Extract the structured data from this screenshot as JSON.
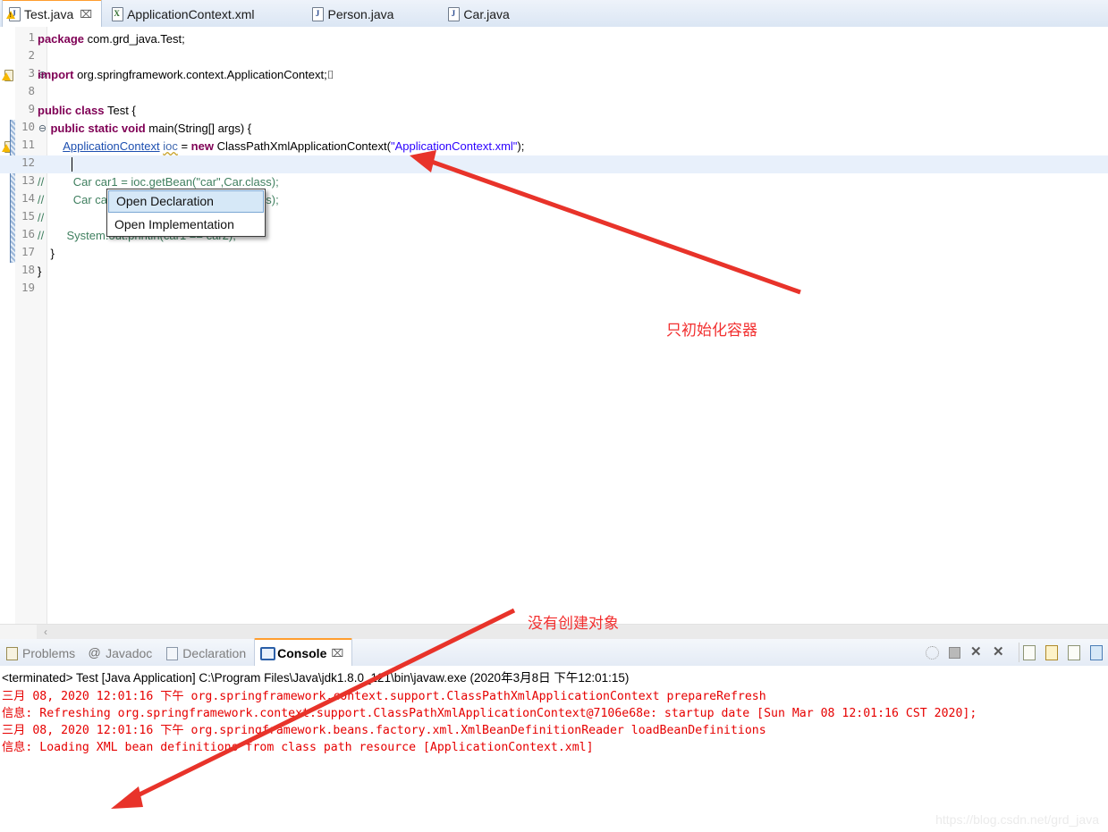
{
  "editor_tabs": [
    {
      "label": "Test.java",
      "icon": "java-file-warning-icon",
      "active": true,
      "closeable": true,
      "close_glyph": "⌧"
    },
    {
      "label": "ApplicationContext.xml",
      "icon": "xml-file-icon",
      "active": false,
      "closeable": false
    },
    {
      "label": "Person.java",
      "icon": "java-file-icon",
      "active": false,
      "closeable": false
    },
    {
      "label": "Car.java",
      "icon": "java-file-icon",
      "active": false,
      "closeable": false
    }
  ],
  "code_lines": [
    {
      "num": "1",
      "segments": [
        {
          "t": "package ",
          "c": "kw"
        },
        {
          "t": "com.grd_java.Test;",
          "c": ""
        }
      ]
    },
    {
      "num": "2",
      "segments": []
    },
    {
      "num": "3",
      "segments": [
        {
          "t": "import ",
          "c": "kw"
        },
        {
          "t": "org.springframework.context.ApplicationContext;⌷",
          "c": ""
        }
      ],
      "fold": "⊕",
      "warn": true
    },
    {
      "num": "8",
      "segments": []
    },
    {
      "num": "9",
      "segments": [
        {
          "t": "public ",
          "c": "kw"
        },
        {
          "t": "class ",
          "c": "kw"
        },
        {
          "t": "Test {",
          "c": ""
        }
      ]
    },
    {
      "num": "10",
      "segments": [
        {
          "t": "    ",
          "c": ""
        },
        {
          "t": "public ",
          "c": "kw"
        },
        {
          "t": "static ",
          "c": "kw"
        },
        {
          "t": "void ",
          "c": "kw"
        },
        {
          "t": "main(String[] args) {",
          "c": ""
        }
      ],
      "fold": "⊖"
    },
    {
      "num": "11",
      "segments": [
        {
          "t": "        ",
          "c": ""
        },
        {
          "t": "ApplicationContext",
          "c": "lnk"
        },
        {
          "t": " ",
          "c": ""
        },
        {
          "t": "ioc",
          "c": "fld"
        },
        {
          "t": " = ",
          "c": ""
        },
        {
          "t": "new ",
          "c": "kw"
        },
        {
          "t": "ClassPathXmlApplicationContext(",
          "c": ""
        },
        {
          "t": "\"ApplicationContext.xml\"",
          "c": "str"
        },
        {
          "t": ");",
          "c": ""
        }
      ],
      "warn": true
    },
    {
      "num": "12",
      "segments": [],
      "highlight": true
    },
    {
      "num": "13",
      "segments": [
        {
          "t": "//         Car car1 = ioc.getBean(\"car\",Car.class);",
          "c": "cmt"
        }
      ]
    },
    {
      "num": "14",
      "segments": [
        {
          "t": "//         Car car2 = ioc.getBean(\"car\",Car.class);",
          "c": "cmt"
        }
      ]
    },
    {
      "num": "15",
      "segments": [
        {
          "t": "//",
          "c": "cmt"
        }
      ]
    },
    {
      "num": "16",
      "segments": [
        {
          "t": "//       System.out.println(car1 == car2);",
          "c": "cmt"
        }
      ]
    },
    {
      "num": "17",
      "segments": [
        {
          "t": "    }",
          "c": ""
        }
      ]
    },
    {
      "num": "18",
      "segments": [
        {
          "t": "}",
          "c": ""
        }
      ]
    },
    {
      "num": "19",
      "segments": []
    }
  ],
  "context_menu": {
    "items": [
      {
        "label": "Open Declaration",
        "selected": true
      },
      {
        "label": "Open Implementation",
        "selected": false
      }
    ]
  },
  "annotations": [
    {
      "text": "只初始化容器",
      "name": "annotation-only-init-container"
    },
    {
      "text": "没有创建对象",
      "name": "annotation-no-object-created"
    }
  ],
  "annotation_color": "#f23030",
  "bottom_tabs": [
    {
      "label": "Problems",
      "icon": "problems-icon",
      "active": false
    },
    {
      "label": "Javadoc",
      "icon": "javadoc-at-icon",
      "active": false
    },
    {
      "label": "Declaration",
      "icon": "declaration-icon",
      "active": false
    },
    {
      "label": "Console",
      "icon": "console-icon",
      "active": true,
      "close_glyph": "⌧"
    }
  ],
  "console_toolbar": [
    {
      "name": "terminate-all-icon"
    },
    {
      "name": "stop-icon"
    },
    {
      "name": "remove-launch-icon"
    },
    {
      "name": "remove-all-terminated-icon"
    },
    {
      "name": "clear-console-icon"
    },
    {
      "name": "scroll-lock-icon"
    },
    {
      "name": "show-console-on-output-icon"
    },
    {
      "name": "display-selected-console-icon"
    }
  ],
  "console": {
    "lines": [
      {
        "text": "<terminated> Test [Java Application] C:\\Program Files\\Java\\jdk1.8.0_121\\bin\\javaw.exe (2020年3月8日 下午12:01:15)",
        "type": "terminated"
      },
      {
        "text": "三月 08, 2020 12:01:16 下午 org.springframework.context.support.ClassPathXmlApplicationContext prepareRefresh",
        "type": "stderr"
      },
      {
        "text": "信息: Refreshing org.springframework.context.support.ClassPathXmlApplicationContext@7106e68e: startup date [Sun Mar 08 12:01:16 CST 2020];",
        "type": "stderr"
      },
      {
        "text": "三月 08, 2020 12:01:16 下午 org.springframework.beans.factory.xml.XmlBeanDefinitionReader loadBeanDefinitions",
        "type": "stderr"
      },
      {
        "text": "信息: Loading XML bean definitions from class path resource [ApplicationContext.xml]",
        "type": "stderr"
      }
    ]
  },
  "watermark": "https://blog.csdn.net/grd_java",
  "scrollbar": {
    "left_arrow": "‹"
  }
}
